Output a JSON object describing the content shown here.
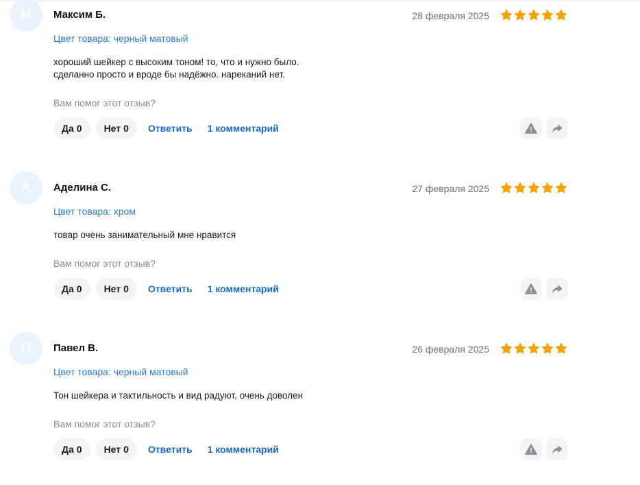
{
  "colors": {
    "accent": "#1769d3",
    "star": "#f5a300",
    "muted": "#858a93",
    "pill_bg": "#f3f4f6",
    "avatar_bg": "#e9f3fd"
  },
  "reviews": [
    {
      "avatar_letter": "М",
      "author": "Максим Б.",
      "date": "28 февраля 2025",
      "rating": 5,
      "color_line": "Цвет товара: черный матовый",
      "text_lines": [
        "хороший шейкер с высоким тоном! то, что и нужно было.",
        "сделанно просто и вроде бы надёжно. нареканий нет."
      ],
      "helpful_question": "Вам помог этот отзыв?",
      "yes_label": "Да",
      "yes_count": "0",
      "no_label": "Нет",
      "no_count": "0",
      "reply_label": "Ответить",
      "comments_label": "1 комментарий",
      "report_icon": "warning-icon",
      "share_icon": "share-arrow-icon"
    },
    {
      "avatar_letter": "А",
      "author": "Аделина С.",
      "date": "27 февраля 2025",
      "rating": 5,
      "color_line": "Цвет товара: хром",
      "text_lines": [
        "товар очень занимательный мне нравится"
      ],
      "helpful_question": "Вам помог этот отзыв?",
      "yes_label": "Да",
      "yes_count": "0",
      "no_label": "Нет",
      "no_count": "0",
      "reply_label": "Ответить",
      "comments_label": "1 комментарий",
      "report_icon": "warning-icon",
      "share_icon": "share-arrow-icon"
    },
    {
      "avatar_letter": "П",
      "author": "Павел В.",
      "date": "26 февраля 2025",
      "rating": 5,
      "color_line": "Цвет товара: черный матовый",
      "text_lines": [
        "Тон шейкера и тактильность и вид радуют, очень доволен"
      ],
      "helpful_question": "Вам помог этот отзыв?",
      "yes_label": "Да",
      "yes_count": "0",
      "no_label": "Нет",
      "no_count": "0",
      "reply_label": "Ответить",
      "comments_label": "1 комментарий",
      "report_icon": "warning-icon",
      "share_icon": "share-arrow-icon"
    }
  ]
}
